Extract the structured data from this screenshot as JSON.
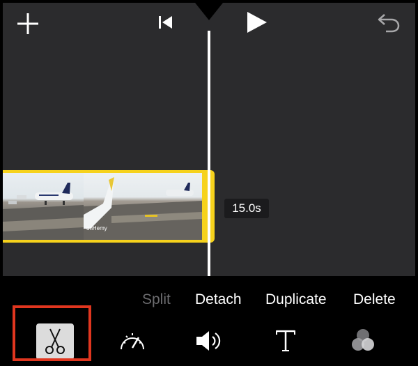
{
  "top_toolbar": {
    "add_icon": "plus-icon",
    "skip_back_icon": "skip-to-start-icon",
    "play_icon": "play-icon",
    "undo_icon": "undo-icon"
  },
  "clip": {
    "duration": "15.0s",
    "selected_color": "#f6d21c",
    "watermark_text": "unHemy"
  },
  "actions": {
    "split_label": "Split",
    "detach_label": "Detach",
    "duplicate_label": "Duplicate",
    "delete_label": "Delete"
  },
  "tools": [
    {
      "icon": "scissors-icon",
      "selected": true
    },
    {
      "icon": "speedometer-icon",
      "selected": false
    },
    {
      "icon": "volume-icon",
      "selected": false
    },
    {
      "icon": "text-icon",
      "selected": false
    },
    {
      "icon": "filters-icon",
      "selected": false
    }
  ],
  "colors": {
    "background": "#000000",
    "timeline_bg": "#2b2b2d",
    "highlight": "#e0361f",
    "disabled_text": "#6b6b6e"
  }
}
